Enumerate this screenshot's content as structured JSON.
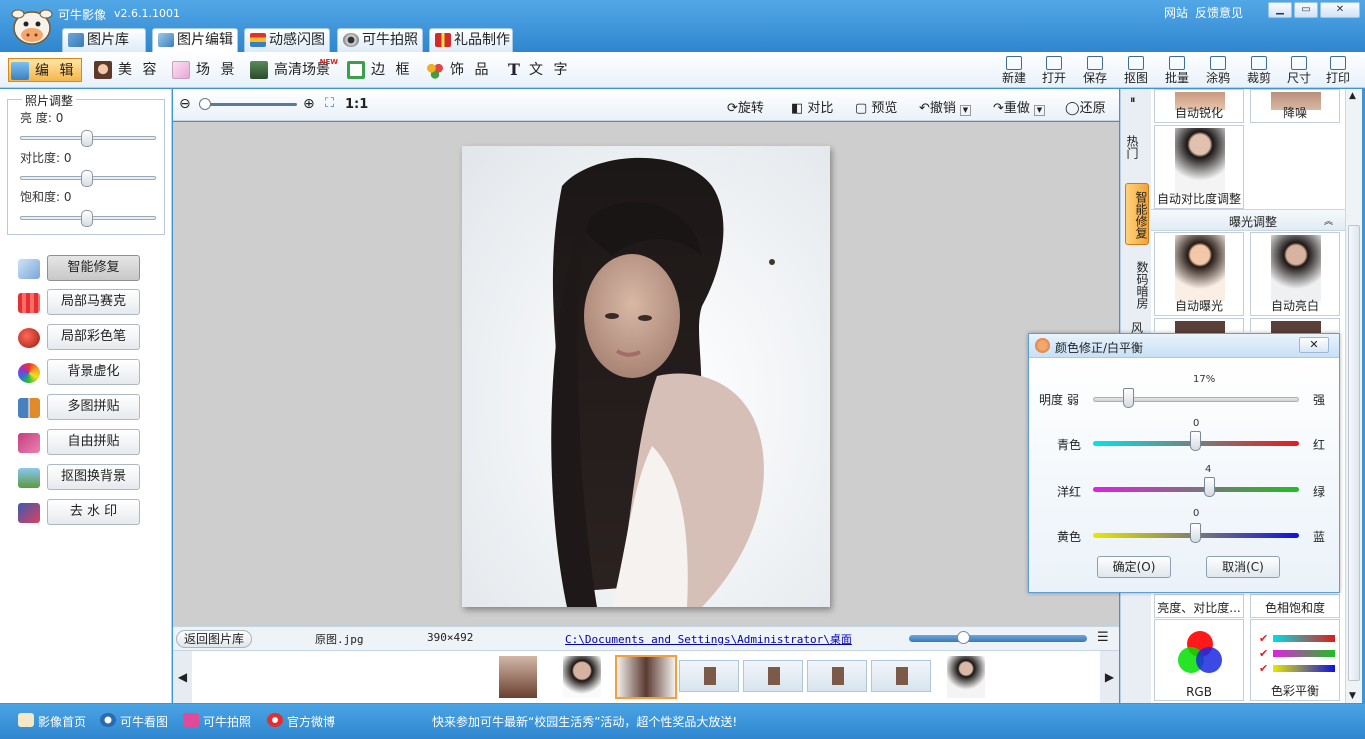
{
  "app": {
    "title": "可牛影像",
    "version": "v2.6.1.1001"
  },
  "top_links": {
    "website": "网站",
    "feedback": "反馈意见"
  },
  "window_controls": {
    "minimize": "▁",
    "restore": "▭",
    "close": "✕"
  },
  "main_tabs": [
    {
      "label": "图片库",
      "icon": "gallery-icon"
    },
    {
      "label": "图片编辑",
      "icon": "edit-picture-icon"
    },
    {
      "label": "动感闪图",
      "icon": "flash-image-icon"
    },
    {
      "label": "可牛拍照",
      "icon": "camera-icon"
    },
    {
      "label": "礼品制作",
      "icon": "gift-icon"
    }
  ],
  "sub_tabs": [
    {
      "label": "编 辑",
      "icon": "edit-icon"
    },
    {
      "label": "美 容",
      "icon": "beauty-icon"
    },
    {
      "label": "场 景",
      "icon": "scene-icon"
    },
    {
      "label": "高清场景",
      "icon": "hd-scene-icon",
      "badge": "NEW"
    },
    {
      "label": "边 框",
      "icon": "frame-icon"
    },
    {
      "label": "饰 品",
      "icon": "decoration-icon"
    },
    {
      "label": "文 字",
      "icon": "text-icon",
      "glyph": "T"
    }
  ],
  "right_tools": [
    {
      "label": "新建",
      "icon": "new-file-icon"
    },
    {
      "label": "打开",
      "icon": "open-folder-icon"
    },
    {
      "label": "保存",
      "icon": "save-icon"
    },
    {
      "label": "抠图",
      "icon": "cutout-icon"
    },
    {
      "label": "批量",
      "icon": "batch-icon"
    },
    {
      "label": "涂鸦",
      "icon": "doodle-icon"
    },
    {
      "label": "裁剪",
      "icon": "crop-icon"
    },
    {
      "label": "尺寸",
      "icon": "resize-icon"
    },
    {
      "label": "打印",
      "icon": "print-icon"
    }
  ],
  "photo_adjust": {
    "title": "照片调整",
    "sliders": [
      {
        "label": "亮  度:",
        "value": "0"
      },
      {
        "label": "对比度:",
        "value": "0"
      },
      {
        "label": "饱和度:",
        "value": "0"
      }
    ]
  },
  "left_tools": [
    {
      "label": "智能修复",
      "icon": "smart-repair-icon",
      "color": "#7aa7d8"
    },
    {
      "label": "局部马赛克",
      "icon": "mosaic-icon",
      "color": "#e53030"
    },
    {
      "label": "局部彩色笔",
      "icon": "color-pen-icon",
      "color": "#c83a2a"
    },
    {
      "label": "背景虚化",
      "icon": "blur-background-icon",
      "color": "#f0a020"
    },
    {
      "label": "多图拼贴",
      "icon": "multi-collage-icon",
      "color": "#4a7fc0"
    },
    {
      "label": "自由拼贴",
      "icon": "free-collage-icon",
      "color": "#c04080"
    },
    {
      "label": "抠图换背景",
      "icon": "change-background-icon",
      "color": "#5a9a40"
    },
    {
      "label": "去 水 印",
      "icon": "remove-watermark-icon",
      "color": "#3a5ab0"
    }
  ],
  "canvas_bar": {
    "zoom_ratio": "1:1",
    "rotate": "旋转",
    "compare": "对比",
    "preview": "预览",
    "undo": "撤销",
    "redo": "重做",
    "restore": "还原"
  },
  "status": {
    "back": "返回图片库",
    "filename": "原图.jpg",
    "dimensions": "390×492",
    "path": "C:\\Documents and Settings\\Administrator\\桌面"
  },
  "vertical_tabs": [
    {
      "label": "热门"
    },
    {
      "label": "智能修复"
    },
    {
      "label": "数码暗房"
    },
    {
      "label": "风"
    }
  ],
  "effects": {
    "top_row": [
      "自动锐化",
      "降噪"
    ],
    "auto_contrast": "自动对比度调整",
    "section_title": "曝光调整",
    "exposure_row": [
      "自动曝光",
      "自动亮白"
    ],
    "lower_row": [
      "亮度、对比度...",
      "色相饱和度"
    ],
    "bottom_row": [
      "RGB",
      "色彩平衡"
    ]
  },
  "dialog": {
    "title": "颜色修正/白平衡",
    "sliders": [
      {
        "label_left": "明度  弱",
        "label_right": "强",
        "value": "17%",
        "level": 0.17,
        "track": "linear-gradient(#e6e6e6,#cfcfcf)"
      },
      {
        "label_left": "青色",
        "label_right": "红",
        "value": "0",
        "level": 0.5,
        "track": "linear-gradient(90deg,#00e5e5,#e61b1b)"
      },
      {
        "label_left": "洋红",
        "label_right": "绿",
        "value": "4",
        "level": 0.57,
        "track": "linear-gradient(90deg,#e020e0,#20c020)"
      },
      {
        "label_left": "黄色",
        "label_right": "蓝",
        "value": "0",
        "level": 0.5,
        "track": "linear-gradient(90deg,#e8e800,#1010e0)"
      }
    ],
    "ok": "确定(O)",
    "cancel": "取消(C)"
  },
  "bottom_links": [
    {
      "label": "影像首页",
      "icon": "home-icon"
    },
    {
      "label": "可牛看图",
      "icon": "viewer-icon"
    },
    {
      "label": "可牛拍照",
      "icon": "camera-icon"
    },
    {
      "label": "官方微博",
      "icon": "weibo-icon"
    }
  ],
  "announcement": "快来参加可牛最新“校园生活秀”活动，超个性奖品大放送!"
}
